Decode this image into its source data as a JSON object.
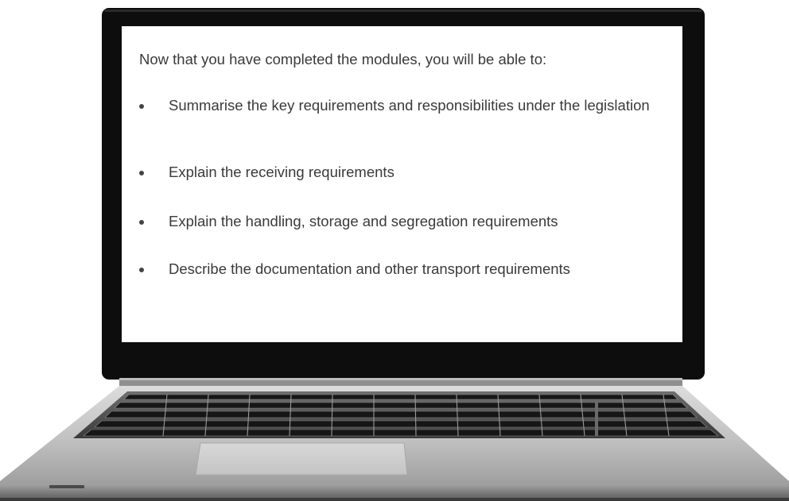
{
  "screen": {
    "intro": "Now that you have completed the modules, you will be able to:",
    "outcomes": [
      "Summarise the key requirements and responsibilities under the legislation",
      "Explain the receiving requirements",
      "Explain the handling, storage and segregation requirements",
      "Describe the documentation and other transport requirements"
    ]
  },
  "colors": {
    "bezel": "#0d0d0d",
    "screen_bg": "#ffffff",
    "text": "#3a3a3a",
    "chassis": "#b9b9b9",
    "keyboard_deck": "#555555"
  }
}
